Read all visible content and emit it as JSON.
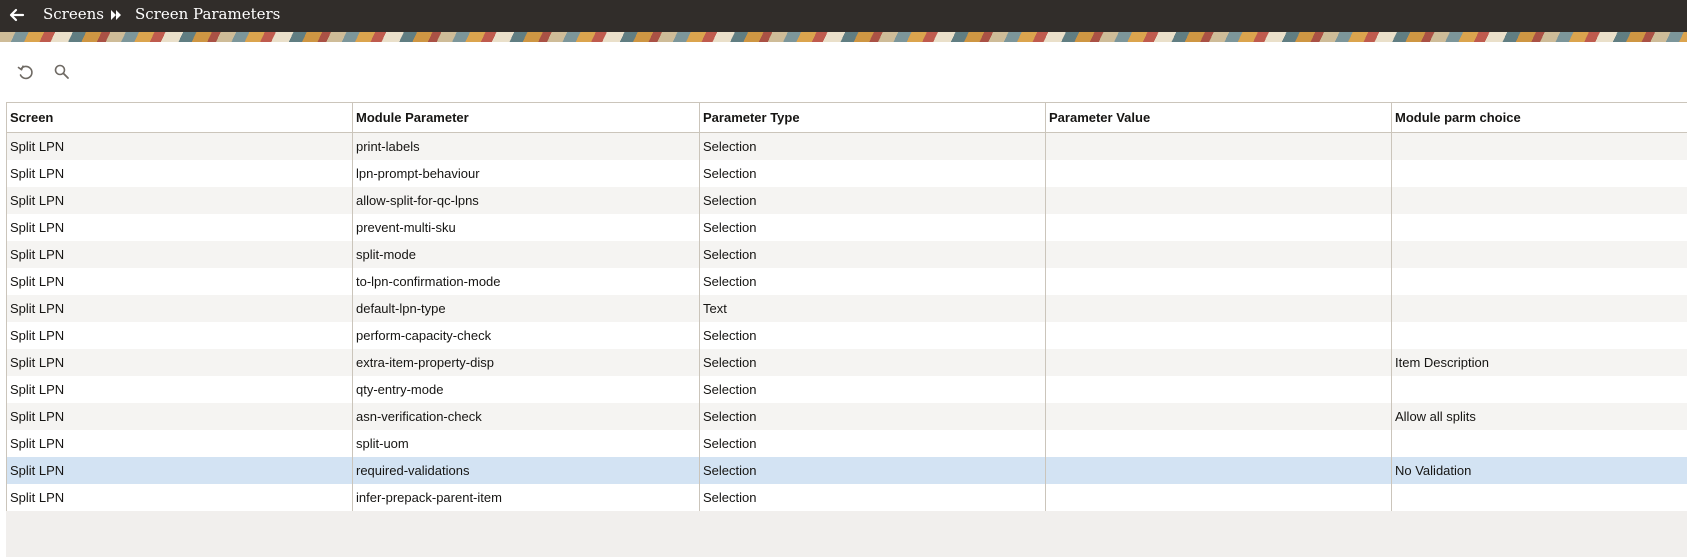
{
  "header": {
    "breadcrumb": [
      {
        "label": "Screens"
      },
      {
        "label": "Screen Parameters"
      }
    ]
  },
  "toolbar": {
    "refresh_icon": "refresh-icon",
    "search_icon": "search-icon"
  },
  "table": {
    "columns": [
      "Screen",
      "Module Parameter",
      "Parameter Type",
      "Parameter Value",
      "Module parm choice"
    ],
    "rows": [
      {
        "screen": "Split LPN",
        "parameter": "print-labels",
        "type": "Selection",
        "value": "",
        "choice": ""
      },
      {
        "screen": "Split LPN",
        "parameter": "lpn-prompt-behaviour",
        "type": "Selection",
        "value": "",
        "choice": ""
      },
      {
        "screen": "Split LPN",
        "parameter": "allow-split-for-qc-lpns",
        "type": "Selection",
        "value": "",
        "choice": ""
      },
      {
        "screen": "Split LPN",
        "parameter": "prevent-multi-sku",
        "type": "Selection",
        "value": "",
        "choice": ""
      },
      {
        "screen": "Split LPN",
        "parameter": "split-mode",
        "type": "Selection",
        "value": "",
        "choice": ""
      },
      {
        "screen": "Split LPN",
        "parameter": "to-lpn-confirmation-mode",
        "type": "Selection",
        "value": "",
        "choice": ""
      },
      {
        "screen": "Split LPN",
        "parameter": "default-lpn-type",
        "type": "Text",
        "value": "",
        "choice": ""
      },
      {
        "screen": "Split LPN",
        "parameter": "perform-capacity-check",
        "type": "Selection",
        "value": "",
        "choice": ""
      },
      {
        "screen": "Split LPN",
        "parameter": "extra-item-property-disp",
        "type": "Selection",
        "value": "",
        "choice": "Item Description"
      },
      {
        "screen": "Split LPN",
        "parameter": "qty-entry-mode",
        "type": "Selection",
        "value": "",
        "choice": ""
      },
      {
        "screen": "Split LPN",
        "parameter": "asn-verification-check",
        "type": "Selection",
        "value": "",
        "choice": "Allow all splits"
      },
      {
        "screen": "Split LPN",
        "parameter": "split-uom",
        "type": "Selection",
        "value": "",
        "choice": ""
      },
      {
        "screen": "Split LPN",
        "parameter": "required-validations",
        "type": "Selection",
        "value": "",
        "choice": "No Validation",
        "selected": true
      },
      {
        "screen": "Split LPN",
        "parameter": "infer-prepack-parent-item",
        "type": "Selection",
        "value": "",
        "choice": ""
      }
    ]
  },
  "colors": {
    "header_bg": "#312d2a",
    "selected_row": "#d3e3f3",
    "grid_border": "#cbc5bb"
  }
}
